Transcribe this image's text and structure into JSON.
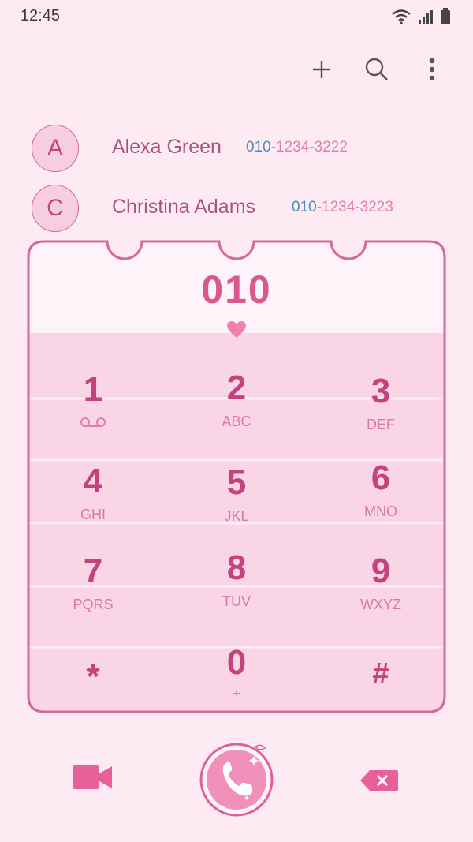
{
  "status": {
    "time": "12:45"
  },
  "contacts": [
    {
      "initial": "A",
      "name": "Alexa Green",
      "number_prefix": "010",
      "number_rest": "-1234-3222"
    },
    {
      "initial": "C",
      "name": "Christina Adams",
      "number_prefix": "010",
      "number_rest": "-1234-3223"
    }
  ],
  "dialer": {
    "entered_digits": "010",
    "keys": [
      {
        "main": "1",
        "sub": ""
      },
      {
        "main": "2",
        "sub": "ABC"
      },
      {
        "main": "3",
        "sub": "DEF"
      },
      {
        "main": "4",
        "sub": "GHI"
      },
      {
        "main": "5",
        "sub": "JKL"
      },
      {
        "main": "6",
        "sub": "MNO"
      },
      {
        "main": "7",
        "sub": "PQRS"
      },
      {
        "main": "8",
        "sub": "TUV"
      },
      {
        "main": "9",
        "sub": "WXYZ"
      },
      {
        "main": "*",
        "sub": ""
      },
      {
        "main": "0",
        "sub": "+"
      },
      {
        "main": "#",
        "sub": ""
      }
    ]
  },
  "icons": {
    "toolbar": [
      "plus-icon",
      "search-icon",
      "more-vert-icon"
    ],
    "bottom": [
      "video-call-icon",
      "phone-icon",
      "backspace-icon"
    ],
    "voicemail": "voicemail-icon"
  },
  "colors": {
    "background": "#fdeaf3",
    "accent": "#d9598f",
    "keypad": "#f9d5e6",
    "border": "#d26a98"
  }
}
